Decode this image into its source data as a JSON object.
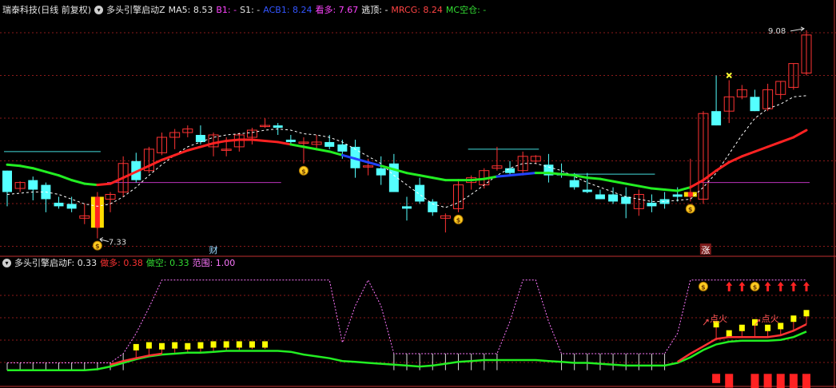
{
  "header_main": {
    "stock": "瑞泰科技(日线 前复权)",
    "indicator": "多头引擎启动Z",
    "items": [
      {
        "label": "MA5: ",
        "value": "8.53",
        "color": "#e6e6e6"
      },
      {
        "label": "B1: ",
        "value": "-",
        "color": "#ff44ff"
      },
      {
        "label": "S1: ",
        "value": "-",
        "color": "#e6e6e6"
      },
      {
        "label": "ACB1: ",
        "value": "8.24",
        "color": "#3355ff"
      },
      {
        "label": "看多: ",
        "value": "7.67",
        "color": "#ff44ff"
      },
      {
        "label": "逃顶: ",
        "value": "-",
        "color": "#ffffff"
      },
      {
        "label": "MRCG: ",
        "value": "8.24",
        "color": "#ff4444"
      },
      {
        "label": "MC空仓: ",
        "value": "-",
        "color": "#33dd33"
      }
    ]
  },
  "header_sub": {
    "indicator": "多头引擎启动F",
    "items": [
      {
        "label": ": ",
        "value": "0.33",
        "color": "#e6e6e6"
      },
      {
        "label": "做多: ",
        "value": "0.38",
        "color": "#ff3333"
      },
      {
        "label": "做空: ",
        "value": "0.33",
        "color": "#33dd33"
      },
      {
        "label": "范围: ",
        "value": "1.00",
        "color": "#ff77ff"
      }
    ]
  },
  "price_labels": {
    "high": "9.08",
    "low": "7.33"
  },
  "markers": {
    "cai": "财",
    "zhang": "涨",
    "dianhuo": "点火"
  },
  "colors": {
    "up": "#ff3333",
    "down": "#54ffff",
    "ma_white": "#ffffff",
    "acb_red": "#ff2222",
    "acb_green": "#22ee22",
    "acb_blue": "#2244ff",
    "range_pink": "#ff77ff",
    "grid": "#8b1a1a",
    "signal_yellow": "#ffff00"
  },
  "chart_data": [
    {
      "type": "candlestick",
      "title": "多头引擎启动Z",
      "ylim": [
        7.2,
        9.2
      ],
      "bars_ohlc": [
        [
          7.9,
          7.9,
          7.6,
          7.72
        ],
        [
          7.75,
          7.81,
          7.72,
          7.8
        ],
        [
          7.82,
          7.85,
          7.65,
          7.74
        ],
        [
          7.78,
          7.8,
          7.55,
          7.66
        ],
        [
          7.63,
          7.68,
          7.58,
          7.6
        ],
        [
          7.62,
          7.68,
          7.55,
          7.58
        ],
        [
          7.5,
          7.62,
          7.45,
          7.52
        ],
        [
          7.42,
          7.72,
          7.33,
          7.68
        ],
        [
          7.66,
          7.72,
          7.55,
          7.7
        ],
        [
          7.72,
          8.02,
          7.68,
          7.96
        ],
        [
          7.98,
          8.05,
          7.8,
          7.82
        ],
        [
          7.9,
          8.1,
          7.88,
          8.08
        ],
        [
          8.05,
          8.22,
          8.03,
          8.18
        ],
        [
          8.18,
          8.25,
          8.08,
          8.22
        ],
        [
          8.22,
          8.28,
          8.18,
          8.25
        ],
        [
          8.2,
          8.28,
          8.12,
          8.14
        ],
        [
          8.1,
          8.22,
          8.02,
          8.2
        ],
        [
          8.08,
          8.18,
          8.02,
          8.08
        ],
        [
          8.1,
          8.22,
          8.06,
          8.2
        ],
        [
          8.18,
          8.26,
          8.12,
          8.24
        ],
        [
          8.28,
          8.34,
          8.26,
          8.28
        ],
        [
          8.28,
          8.3,
          8.2,
          8.26
        ],
        [
          8.16,
          8.2,
          8.12,
          8.14
        ],
        [
          8.14,
          8.18,
          7.96,
          8.14
        ],
        [
          8.12,
          8.2,
          8.08,
          8.14
        ],
        [
          8.14,
          8.2,
          8.08,
          8.1
        ],
        [
          8.12,
          8.16,
          8.0,
          8.06
        ],
        [
          8.1,
          8.16,
          7.84,
          7.92
        ],
        [
          7.94,
          8.0,
          7.86,
          7.94
        ],
        [
          7.92,
          8.02,
          7.78,
          7.86
        ],
        [
          7.96,
          8.04,
          7.72,
          7.72
        ],
        [
          7.6,
          7.68,
          7.48,
          7.58
        ],
        [
          7.78,
          7.84,
          7.62,
          7.64
        ],
        [
          7.64,
          7.66,
          7.52,
          7.55
        ],
        [
          7.5,
          7.54,
          7.38,
          7.52
        ],
        [
          7.58,
          7.82,
          7.55,
          7.78
        ],
        [
          7.8,
          7.86,
          7.74,
          7.84
        ],
        [
          7.78,
          7.92,
          7.75,
          7.9
        ],
        [
          7.92,
          8.1,
          7.9,
          7.94
        ],
        [
          7.92,
          7.98,
          7.86,
          7.88
        ],
        [
          7.9,
          8.06,
          7.86,
          8.02
        ],
        [
          7.98,
          8.03,
          7.96,
          8.02
        ],
        [
          7.95,
          8.04,
          7.8,
          7.86
        ],
        [
          7.88,
          7.96,
          7.84,
          7.86
        ],
        [
          7.82,
          7.88,
          7.74,
          7.76
        ],
        [
          7.74,
          7.88,
          7.71,
          7.72
        ],
        [
          7.7,
          7.74,
          7.66,
          7.66
        ],
        [
          7.7,
          7.76,
          7.62,
          7.64
        ],
        [
          7.68,
          7.76,
          7.5,
          7.62
        ],
        [
          7.58,
          7.74,
          7.52,
          7.7
        ],
        [
          7.63,
          7.7,
          7.55,
          7.6
        ],
        [
          7.66,
          7.72,
          7.58,
          7.62
        ],
        [
          7.7,
          7.76,
          7.64,
          7.68
        ],
        [
          7.68,
          8.0,
          7.64,
          7.72
        ],
        [
          7.66,
          8.4,
          7.62,
          8.38
        ],
        [
          8.4,
          8.7,
          8.28,
          8.28
        ],
        [
          8.4,
          8.66,
          8.3,
          8.52
        ],
        [
          8.52,
          8.62,
          8.5,
          8.58
        ],
        [
          8.52,
          8.58,
          8.4,
          8.4
        ],
        [
          8.42,
          8.63,
          8.4,
          8.58
        ],
        [
          8.54,
          8.65,
          8.5,
          8.65
        ],
        [
          8.6,
          8.8,
          8.58,
          8.8
        ],
        [
          8.72,
          9.08,
          8.7,
          9.04
        ]
      ],
      "series": [
        {
          "name": "MA5",
          "values": [
            7.7,
            7.71,
            7.72,
            7.72,
            7.7,
            7.66,
            7.62,
            7.6,
            7.62,
            7.68,
            7.76,
            7.86,
            7.95,
            8.03,
            8.1,
            8.14,
            8.18,
            8.2,
            8.21,
            8.22,
            8.24,
            8.25,
            8.24,
            8.21,
            8.2,
            8.18,
            8.14,
            8.08,
            8.02,
            7.96,
            7.86,
            7.78,
            7.7,
            7.62,
            7.59,
            7.63,
            7.7,
            7.78,
            7.86,
            7.92,
            7.96,
            7.96,
            7.93,
            7.9,
            7.85,
            7.8,
            7.76,
            7.72,
            7.68,
            7.66,
            7.64,
            7.64,
            7.65,
            7.66,
            7.76,
            7.88,
            8.04,
            8.2,
            8.34,
            8.42,
            8.46,
            8.52,
            8.53
          ]
        },
        {
          "name": "MRCG",
          "values": [
            7.95,
            7.94,
            7.92,
            7.89,
            7.86,
            7.82,
            7.79,
            7.78,
            7.79,
            7.84,
            7.89,
            7.94,
            7.99,
            8.03,
            8.07,
            8.1,
            8.13,
            8.15,
            8.16,
            8.16,
            8.15,
            8.14,
            8.12,
            8.1,
            8.08,
            8.06,
            8.03,
            8.0,
            7.97,
            7.94,
            7.91,
            7.88,
            7.86,
            7.84,
            7.82,
            7.82,
            7.82,
            7.83,
            7.85,
            7.86,
            7.87,
            7.88,
            7.88,
            7.87,
            7.86,
            7.84,
            7.83,
            7.81,
            7.79,
            7.77,
            7.75,
            7.74,
            7.73,
            7.76,
            7.82,
            7.9,
            7.97,
            8.02,
            8.06,
            8.1,
            8.14,
            8.18,
            8.24
          ]
        },
        {
          "name": "B1",
          "values": [
            8.06,
            8.06,
            8.06,
            8.06,
            8.06,
            8.06,
            8.06,
            8.06,
            null,
            null,
            null,
            null,
            null,
            null,
            null,
            null,
            null,
            null,
            null,
            null,
            null,
            null,
            null,
            null,
            null,
            null,
            null,
            null,
            null,
            null,
            null,
            null,
            null,
            null,
            null,
            null,
            null,
            null,
            null,
            null,
            null,
            null,
            null,
            null,
            null,
            null,
            null,
            null,
            null,
            null,
            null,
            null,
            null,
            null,
            null,
            null,
            null,
            null,
            null,
            null,
            null,
            null,
            null
          ]
        },
        {
          "name": "看多",
          "values": [
            null,
            null,
            null,
            null,
            null,
            null,
            null,
            null,
            7.8,
            7.8,
            7.8,
            7.8,
            7.8,
            7.8,
            7.8,
            7.8,
            7.8,
            7.8,
            7.8,
            7.8,
            7.8,
            7.8,
            null,
            null,
            null,
            null,
            null,
            null,
            null,
            null,
            null,
            null,
            null,
            null,
            null,
            null,
            null,
            null,
            null,
            null,
            null,
            null,
            null,
            null,
            null,
            null,
            null,
            null,
            null,
            null,
            null,
            null,
            null,
            null,
            7.8,
            7.8,
            7.8,
            7.8,
            7.8,
            7.8,
            7.8,
            7.8,
            7.8
          ]
        },
        {
          "name": "逃顶",
          "values": [
            null,
            null,
            null,
            null,
            null,
            null,
            null,
            null,
            null,
            null,
            null,
            null,
            null,
            null,
            null,
            null,
            null,
            null,
            null,
            null,
            null,
            null,
            null,
            null,
            null,
            null,
            null,
            null,
            null,
            null,
            null,
            null,
            null,
            null,
            null,
            null,
            8.08,
            8.08,
            8.08,
            8.08,
            8.08,
            8.08,
            7.87,
            7.87,
            7.87,
            7.87,
            7.87,
            7.87,
            7.87,
            7.87,
            7.87,
            null,
            null,
            null,
            null,
            null,
            null,
            null,
            null,
            null,
            null,
            null,
            null
          ]
        }
      ],
      "annotations": {
        "start_signal_index": [
          7,
          53
        ],
        "money_bag_index": [
          7,
          23,
          35,
          53
        ],
        "cai_index": 16,
        "zhang_index": 53,
        "x_mark_index": 56
      }
    },
    {
      "type": "line",
      "title": "多头引擎启动F",
      "ylim": [
        0,
        1.12
      ],
      "series": [
        {
          "name": "范围",
          "values": [
            0.1,
            0.1,
            0.1,
            0.1,
            0.1,
            0.1,
            0.1,
            0.1,
            0.1,
            0.2,
            0.42,
            0.7,
            1.0,
            1.0,
            1.0,
            1.0,
            1.0,
            1.0,
            1.0,
            1.0,
            1.0,
            1.0,
            1.0,
            1.0,
            1.0,
            1.0,
            0.32,
            0.72,
            1.0,
            0.72,
            0.2,
            0.2,
            0.2,
            0.2,
            0.2,
            0.2,
            0.2,
            0.2,
            0.2,
            0.55,
            1.0,
            1.0,
            0.55,
            0.2,
            0.2,
            0.2,
            0.2,
            0.2,
            0.2,
            0.2,
            0.2,
            0.2,
            0.42,
            1.0,
            1.0,
            1.0,
            1.0,
            1.0,
            1.0,
            1.0,
            1.0,
            1.0,
            1.0
          ]
        },
        {
          "name": "做多",
          "values": [
            0.02,
            0.02,
            0.02,
            0.02,
            0.02,
            0.02,
            0.02,
            0.05,
            0.08,
            0.12,
            0.15,
            0.18,
            0.2,
            0.21,
            0.22,
            0.22,
            0.23,
            0.24,
            0.24,
            0.25,
            0.25,
            0.25,
            0.24,
            0.21,
            0.19,
            0.17,
            0.14,
            0.13,
            0.12,
            0.11,
            0.1,
            0.09,
            0.08,
            0.09,
            0.11,
            0.13,
            0.14,
            0.15,
            0.15,
            0.15,
            0.15,
            0.15,
            0.14,
            0.13,
            0.12,
            0.12,
            0.11,
            0.1,
            0.09,
            0.09,
            0.09,
            0.08,
            0.11,
            0.2,
            0.28,
            0.36,
            0.38,
            0.38,
            0.38,
            0.38,
            0.4,
            0.45,
            0.52
          ]
        },
        {
          "name": "做空",
          "values": [
            0.02,
            0.02,
            0.02,
            0.02,
            0.02,
            0.02,
            0.02,
            0.03,
            0.06,
            0.1,
            0.14,
            0.17,
            0.19,
            0.2,
            0.21,
            0.21,
            0.22,
            0.23,
            0.23,
            0.23,
            0.23,
            0.23,
            0.22,
            0.19,
            0.17,
            0.15,
            0.12,
            0.11,
            0.1,
            0.09,
            0.08,
            0.07,
            0.06,
            0.07,
            0.09,
            0.11,
            0.12,
            0.13,
            0.13,
            0.13,
            0.13,
            0.13,
            0.12,
            0.11,
            0.1,
            0.1,
            0.09,
            0.08,
            0.07,
            0.07,
            0.07,
            0.07,
            0.1,
            0.16,
            0.24,
            0.3,
            0.33,
            0.34,
            0.34,
            0.34,
            0.35,
            0.38,
            0.44
          ]
        },
        {
          "name": "signal_top",
          "values": [
            null,
            null,
            null,
            null,
            null,
            null,
            null,
            null,
            null,
            null,
            0.27,
            0.29,
            0.28,
            0.29,
            0.28,
            0.29,
            0.3,
            0.3,
            0.3,
            0.3,
            0.3,
            null,
            null,
            null,
            null,
            null,
            null,
            null,
            null,
            null,
            null,
            null,
            null,
            null,
            null,
            null,
            null,
            null,
            null,
            null,
            null,
            null,
            null,
            null,
            null,
            null,
            null,
            null,
            null,
            null,
            null,
            null,
            null,
            null,
            null,
            0.52,
            0.42,
            0.48,
            0.54,
            0.48,
            0.5,
            0.58,
            0.64
          ]
        },
        {
          "name": "signal_bottom",
          "values": [
            null,
            null,
            null,
            null,
            null,
            null,
            null,
            null,
            null,
            null,
            null,
            null,
            null,
            null,
            null,
            null,
            null,
            null,
            null,
            null,
            null,
            null,
            null,
            null,
            null,
            null,
            null,
            null,
            null,
            null,
            null,
            null,
            null,
            null,
            null,
            null,
            null,
            null,
            null,
            null,
            null,
            null,
            null,
            null,
            null,
            null,
            null,
            null,
            null,
            null,
            null,
            null,
            null,
            null,
            null,
            -0.12,
            -0.17,
            null,
            -0.18,
            -0.17,
            -0.18,
            -0.2,
            -0.21
          ]
        }
      ],
      "up_arrow_index": [
        56,
        57,
        59,
        60,
        61,
        62
      ],
      "money_bag_index": [
        54,
        58
      ],
      "dianhuo_index": [
        55,
        59
      ]
    }
  ]
}
